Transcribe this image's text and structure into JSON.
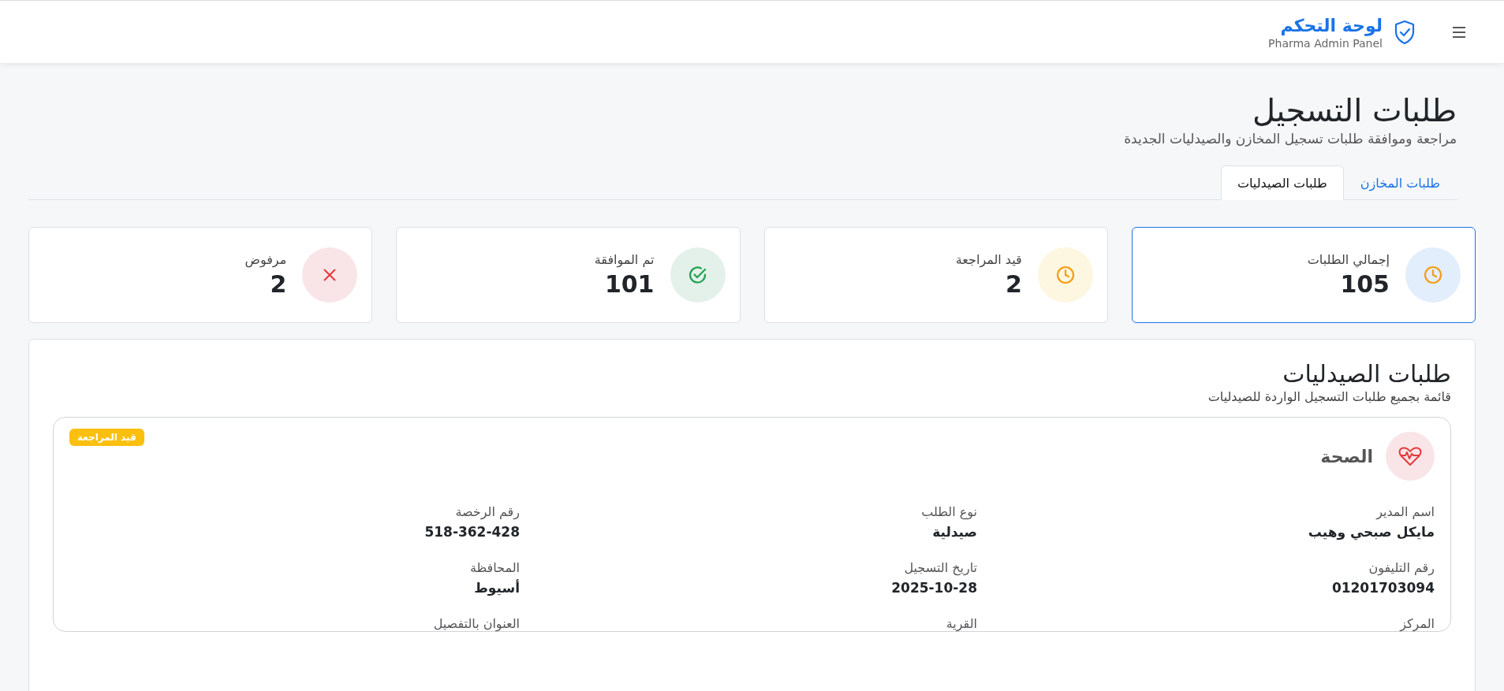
{
  "header": {
    "title": "لوحة التحكم",
    "subtitle": "Pharma Admin Panel"
  },
  "page": {
    "title": "طلبات التسجيل",
    "subtitle": "مراجعة وموافقة طلبات تسجيل المخازن والصيدليات الجديدة"
  },
  "tabs": [
    {
      "label": "طلبات المخازن",
      "selected": false
    },
    {
      "label": "طلبات الصيدليات",
      "selected": true
    }
  ],
  "stats": [
    {
      "label": "إجمالي الطلبات",
      "value": "105",
      "kind": "clock",
      "color": "#e3eefc",
      "selected": true
    },
    {
      "label": "قيد المراجعة",
      "value": "2",
      "kind": "clock",
      "color": "#fdf6e0",
      "selected": false
    },
    {
      "label": "تم الموافقة",
      "value": "101",
      "kind": "check",
      "color": "#e4f1ea",
      "selected": false
    },
    {
      "label": "مرفوض",
      "value": "2",
      "kind": "cross",
      "color": "#f9e5e8",
      "selected": false
    }
  ],
  "list": {
    "title": "طلبات الصيدليات",
    "subtitle": "قائمة بجميع طلبات التسجيل الواردة للصيدليات",
    "requests": [
      {
        "name": "الصحة",
        "status": "قيد المراجعة",
        "fields": [
          {
            "label": "اسم المدير",
            "value": "مايكل صبحي وهيب"
          },
          {
            "label": "نوع الطلب",
            "value": "صيدلية"
          },
          {
            "label": "رقم الرخصة",
            "value": "518-362-428"
          },
          {
            "label": "رقم التليفون",
            "value": "01201703094"
          },
          {
            "label": "تاريخ التسجيل",
            "value": "2025-10-28"
          },
          {
            "label": "المحافظة",
            "value": "أسيوط"
          },
          {
            "label": "المركز"
          },
          {
            "label": "القرية"
          },
          {
            "label": "العنوان بالتفصيل"
          }
        ]
      }
    ]
  }
}
